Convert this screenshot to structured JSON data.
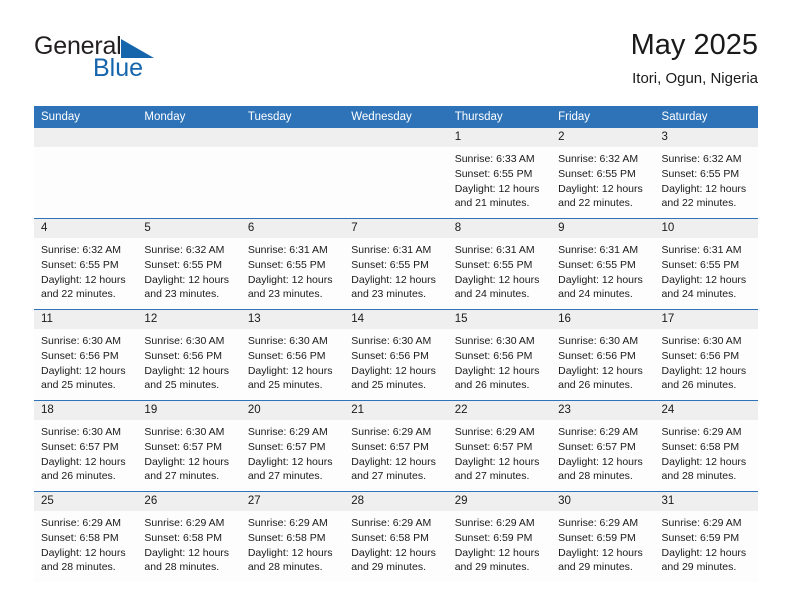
{
  "brand": {
    "name_part1": "General",
    "name_part2": "Blue",
    "triangle_icon": "blue-triangle-logo-mark"
  },
  "header": {
    "title": "May 2025",
    "subtitle": "Itori, Ogun, Nigeria"
  },
  "colors": {
    "header_blue": "#2e73b8",
    "brand_blue": "#1565ad",
    "daynum_band": "#efefef",
    "cell_background": "#fdfdfd",
    "text": "#1a1a1a"
  },
  "calendar": {
    "weekday_headers": [
      "Sunday",
      "Monday",
      "Tuesday",
      "Wednesday",
      "Thursday",
      "Friday",
      "Saturday"
    ],
    "weeks": [
      [
        {
          "day": "",
          "empty": true
        },
        {
          "day": "",
          "empty": true
        },
        {
          "day": "",
          "empty": true
        },
        {
          "day": "",
          "empty": true
        },
        {
          "day": "1",
          "sunrise": "Sunrise: 6:33 AM",
          "sunset": "Sunset: 6:55 PM",
          "daylight_line1": "Daylight: 12 hours",
          "daylight_line2": "and 21 minutes."
        },
        {
          "day": "2",
          "sunrise": "Sunrise: 6:32 AM",
          "sunset": "Sunset: 6:55 PM",
          "daylight_line1": "Daylight: 12 hours",
          "daylight_line2": "and 22 minutes."
        },
        {
          "day": "3",
          "sunrise": "Sunrise: 6:32 AM",
          "sunset": "Sunset: 6:55 PM",
          "daylight_line1": "Daylight: 12 hours",
          "daylight_line2": "and 22 minutes."
        }
      ],
      [
        {
          "day": "4",
          "sunrise": "Sunrise: 6:32 AM",
          "sunset": "Sunset: 6:55 PM",
          "daylight_line1": "Daylight: 12 hours",
          "daylight_line2": "and 22 minutes."
        },
        {
          "day": "5",
          "sunrise": "Sunrise: 6:32 AM",
          "sunset": "Sunset: 6:55 PM",
          "daylight_line1": "Daylight: 12 hours",
          "daylight_line2": "and 23 minutes."
        },
        {
          "day": "6",
          "sunrise": "Sunrise: 6:31 AM",
          "sunset": "Sunset: 6:55 PM",
          "daylight_line1": "Daylight: 12 hours",
          "daylight_line2": "and 23 minutes."
        },
        {
          "day": "7",
          "sunrise": "Sunrise: 6:31 AM",
          "sunset": "Sunset: 6:55 PM",
          "daylight_line1": "Daylight: 12 hours",
          "daylight_line2": "and 23 minutes."
        },
        {
          "day": "8",
          "sunrise": "Sunrise: 6:31 AM",
          "sunset": "Sunset: 6:55 PM",
          "daylight_line1": "Daylight: 12 hours",
          "daylight_line2": "and 24 minutes."
        },
        {
          "day": "9",
          "sunrise": "Sunrise: 6:31 AM",
          "sunset": "Sunset: 6:55 PM",
          "daylight_line1": "Daylight: 12 hours",
          "daylight_line2": "and 24 minutes."
        },
        {
          "day": "10",
          "sunrise": "Sunrise: 6:31 AM",
          "sunset": "Sunset: 6:55 PM",
          "daylight_line1": "Daylight: 12 hours",
          "daylight_line2": "and 24 minutes."
        }
      ],
      [
        {
          "day": "11",
          "sunrise": "Sunrise: 6:30 AM",
          "sunset": "Sunset: 6:56 PM",
          "daylight_line1": "Daylight: 12 hours",
          "daylight_line2": "and 25 minutes."
        },
        {
          "day": "12",
          "sunrise": "Sunrise: 6:30 AM",
          "sunset": "Sunset: 6:56 PM",
          "daylight_line1": "Daylight: 12 hours",
          "daylight_line2": "and 25 minutes."
        },
        {
          "day": "13",
          "sunrise": "Sunrise: 6:30 AM",
          "sunset": "Sunset: 6:56 PM",
          "daylight_line1": "Daylight: 12 hours",
          "daylight_line2": "and 25 minutes."
        },
        {
          "day": "14",
          "sunrise": "Sunrise: 6:30 AM",
          "sunset": "Sunset: 6:56 PM",
          "daylight_line1": "Daylight: 12 hours",
          "daylight_line2": "and 25 minutes."
        },
        {
          "day": "15",
          "sunrise": "Sunrise: 6:30 AM",
          "sunset": "Sunset: 6:56 PM",
          "daylight_line1": "Daylight: 12 hours",
          "daylight_line2": "and 26 minutes."
        },
        {
          "day": "16",
          "sunrise": "Sunrise: 6:30 AM",
          "sunset": "Sunset: 6:56 PM",
          "daylight_line1": "Daylight: 12 hours",
          "daylight_line2": "and 26 minutes."
        },
        {
          "day": "17",
          "sunrise": "Sunrise: 6:30 AM",
          "sunset": "Sunset: 6:56 PM",
          "daylight_line1": "Daylight: 12 hours",
          "daylight_line2": "and 26 minutes."
        }
      ],
      [
        {
          "day": "18",
          "sunrise": "Sunrise: 6:30 AM",
          "sunset": "Sunset: 6:57 PM",
          "daylight_line1": "Daylight: 12 hours",
          "daylight_line2": "and 26 minutes."
        },
        {
          "day": "19",
          "sunrise": "Sunrise: 6:30 AM",
          "sunset": "Sunset: 6:57 PM",
          "daylight_line1": "Daylight: 12 hours",
          "daylight_line2": "and 27 minutes."
        },
        {
          "day": "20",
          "sunrise": "Sunrise: 6:29 AM",
          "sunset": "Sunset: 6:57 PM",
          "daylight_line1": "Daylight: 12 hours",
          "daylight_line2": "and 27 minutes."
        },
        {
          "day": "21",
          "sunrise": "Sunrise: 6:29 AM",
          "sunset": "Sunset: 6:57 PM",
          "daylight_line1": "Daylight: 12 hours",
          "daylight_line2": "and 27 minutes."
        },
        {
          "day": "22",
          "sunrise": "Sunrise: 6:29 AM",
          "sunset": "Sunset: 6:57 PM",
          "daylight_line1": "Daylight: 12 hours",
          "daylight_line2": "and 27 minutes."
        },
        {
          "day": "23",
          "sunrise": "Sunrise: 6:29 AM",
          "sunset": "Sunset: 6:57 PM",
          "daylight_line1": "Daylight: 12 hours",
          "daylight_line2": "and 28 minutes."
        },
        {
          "day": "24",
          "sunrise": "Sunrise: 6:29 AM",
          "sunset": "Sunset: 6:58 PM",
          "daylight_line1": "Daylight: 12 hours",
          "daylight_line2": "and 28 minutes."
        }
      ],
      [
        {
          "day": "25",
          "sunrise": "Sunrise: 6:29 AM",
          "sunset": "Sunset: 6:58 PM",
          "daylight_line1": "Daylight: 12 hours",
          "daylight_line2": "and 28 minutes."
        },
        {
          "day": "26",
          "sunrise": "Sunrise: 6:29 AM",
          "sunset": "Sunset: 6:58 PM",
          "daylight_line1": "Daylight: 12 hours",
          "daylight_line2": "and 28 minutes."
        },
        {
          "day": "27",
          "sunrise": "Sunrise: 6:29 AM",
          "sunset": "Sunset: 6:58 PM",
          "daylight_line1": "Daylight: 12 hours",
          "daylight_line2": "and 28 minutes."
        },
        {
          "day": "28",
          "sunrise": "Sunrise: 6:29 AM",
          "sunset": "Sunset: 6:58 PM",
          "daylight_line1": "Daylight: 12 hours",
          "daylight_line2": "and 29 minutes."
        },
        {
          "day": "29",
          "sunrise": "Sunrise: 6:29 AM",
          "sunset": "Sunset: 6:59 PM",
          "daylight_line1": "Daylight: 12 hours",
          "daylight_line2": "and 29 minutes."
        },
        {
          "day": "30",
          "sunrise": "Sunrise: 6:29 AM",
          "sunset": "Sunset: 6:59 PM",
          "daylight_line1": "Daylight: 12 hours",
          "daylight_line2": "and 29 minutes."
        },
        {
          "day": "31",
          "sunrise": "Sunrise: 6:29 AM",
          "sunset": "Sunset: 6:59 PM",
          "daylight_line1": "Daylight: 12 hours",
          "daylight_line2": "and 29 minutes."
        }
      ]
    ]
  }
}
